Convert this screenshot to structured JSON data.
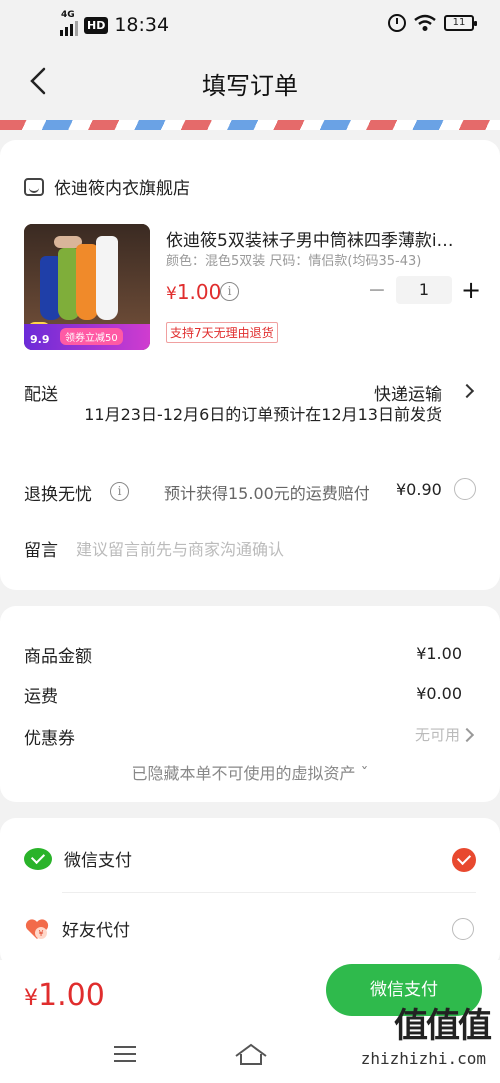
{
  "status_bar": {
    "network": "4G",
    "hd": "HD",
    "time": "18:34",
    "battery": "11"
  },
  "nav": {
    "title": "填写订单"
  },
  "shop": {
    "name": "依迪筱内衣旗舰店"
  },
  "product": {
    "thumb_price": "9.9",
    "thumb_promo": "领券立减50",
    "name": "依迪筱5双装袜子男中筒袜四季薄款i…",
    "spec": "颜色：混色5双装    尺码：情侣款(均码35-43)",
    "price_symbol": "¥",
    "price": "1.00",
    "quantity": "1",
    "return_tag": "支持7天无理由退货"
  },
  "delivery": {
    "label": "配送",
    "method": "快递运输",
    "detail": "11月23日-12月6日的订单预计在12月13日前发货"
  },
  "insurance": {
    "label": "退换无忧",
    "text": "预计获得15.00元的运费赔付",
    "amount": "¥0.90"
  },
  "note": {
    "label": "留言",
    "placeholder": "建议留言前先与商家沟通确认"
  },
  "summary": {
    "goods_label": "商品金额",
    "goods_value": "¥1.00",
    "shipping_label": "运费",
    "shipping_value": "¥0.00",
    "coupon_label": "优惠券",
    "coupon_value": "无可用",
    "hidden_assets": "已隐藏本单不可使用的虚拟资产 ˇ"
  },
  "payment": {
    "wechat_label": "微信支付",
    "friend_label": "好友代付"
  },
  "footer": {
    "total_symbol": "¥",
    "total": "1.00",
    "pay_button": "微信支付"
  },
  "watermark": {
    "text": "zhizhizhi.com",
    "logo": "值值值"
  },
  "colors": {
    "accent_red": "#e02d2d",
    "wechat_green": "#2fba4c",
    "check_red": "#e8492f"
  }
}
